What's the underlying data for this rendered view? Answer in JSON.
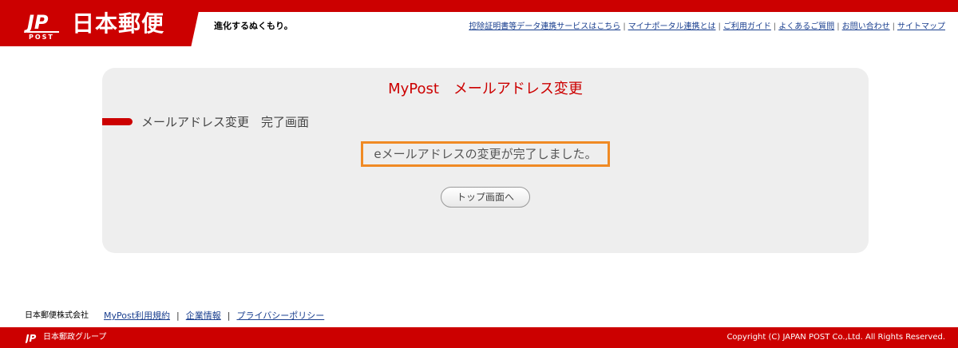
{
  "header": {
    "logo_mark": "JP POST",
    "logo_text": "日本郵便",
    "slogan": "進化するぬくもり。",
    "links": [
      "控除証明書等データ連携サービスはこちら",
      "マイナポータル連携とは",
      "ご利用ガイド",
      "よくあるご質問",
      "お問い合わせ",
      "サイトマップ"
    ],
    "separator": "|"
  },
  "main": {
    "title": "MyPost　メールアドレス変更",
    "section_heading": "メールアドレス変更　完了画面",
    "message": "eメールアドレスの変更が完了しました。",
    "top_button_label": "トップ画面へ"
  },
  "footer": {
    "company": "日本郵便株式会社",
    "links": [
      "MyPost利用規約",
      "企業情報",
      "プライバシーポリシー"
    ],
    "separator": "|",
    "group_mark": "JP",
    "group_text": "日本郵政グループ",
    "copyright": "Copyright (C) JAPAN POST Co.,Ltd. All Rights Reserved."
  },
  "colors": {
    "brand_red": "#cc0000",
    "highlight_orange": "#f08a24",
    "card_gray": "#eeeeee",
    "link_blue": "#1a3f8f"
  }
}
